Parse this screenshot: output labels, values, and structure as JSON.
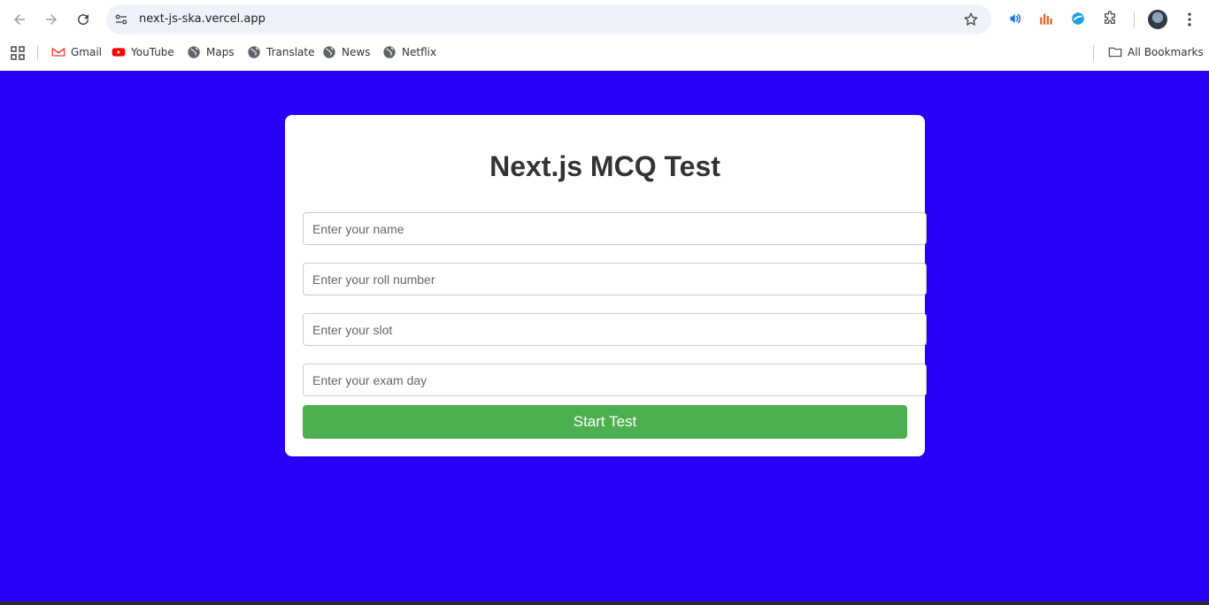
{
  "browser": {
    "url": "next-js-ska.vercel.app",
    "bookmarks": [
      {
        "label": "Gmail",
        "icon": "gmail-icon"
      },
      {
        "label": "YouTube",
        "icon": "youtube-icon"
      },
      {
        "label": "Maps",
        "icon": "globe-icon"
      },
      {
        "label": "Translate",
        "icon": "globe-icon"
      },
      {
        "label": "News",
        "icon": "globe-icon"
      },
      {
        "label": "Netflix",
        "icon": "globe-icon"
      }
    ],
    "all_bookmarks_label": "All Bookmarks"
  },
  "form": {
    "title": "Next.js MCQ Test",
    "name_placeholder": "Enter your name",
    "roll_placeholder": "Enter your roll number",
    "slot_placeholder": "Enter your slot",
    "day_placeholder": "Enter your exam day",
    "start_label": "Start Test"
  },
  "colors": {
    "page_background": "#2600f7",
    "button": "#4caf50"
  }
}
